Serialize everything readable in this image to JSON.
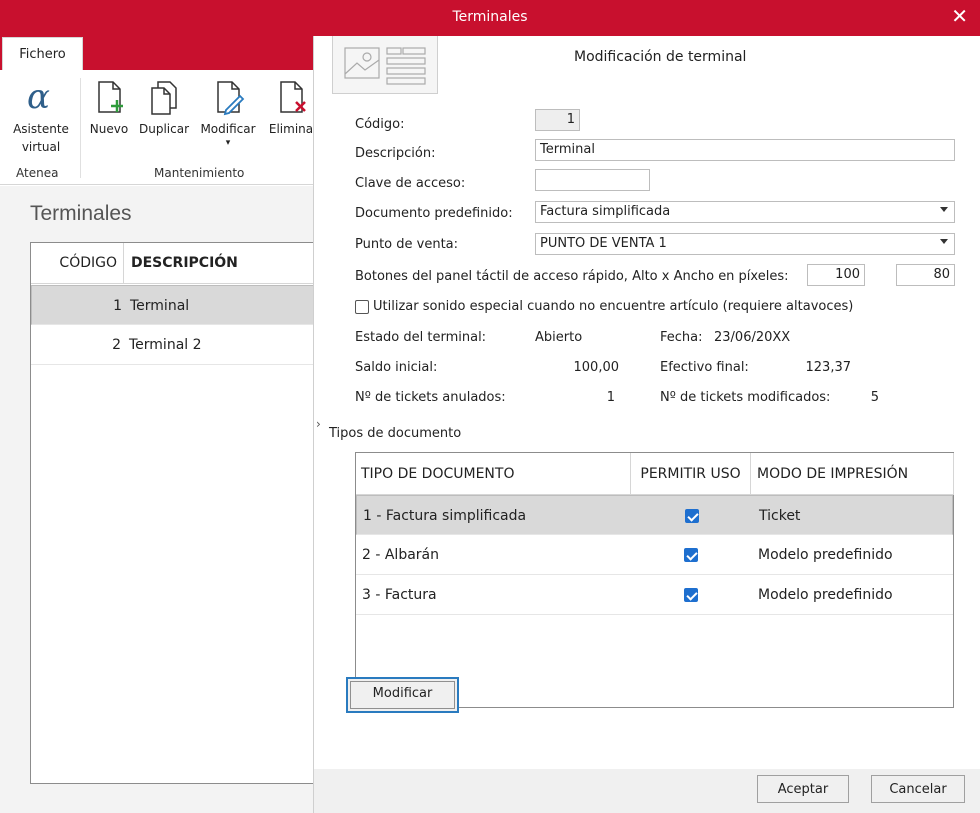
{
  "window": {
    "title": "Terminales"
  },
  "ribbon": {
    "tab": "Fichero",
    "buttons": {
      "asistente": "Asistente virtual",
      "nuevo": "Nuevo",
      "duplicar": "Duplicar",
      "modificar": "Modificar",
      "eliminar": "Elimina"
    },
    "groups": {
      "atenea": "Atenea",
      "mantenimiento": "Mantenimiento"
    }
  },
  "list": {
    "heading": "Terminales",
    "columns": {
      "codigo": "CÓDIGO",
      "descripcion": "DESCRIPCIÓN"
    },
    "rows": [
      {
        "codigo": "1",
        "descripcion": "Terminal"
      },
      {
        "codigo": "2",
        "descripcion": "Terminal 2"
      }
    ]
  },
  "dialog": {
    "title": "Modificación de terminal",
    "labels": {
      "codigo": "Código:",
      "descripcion": "Descripción:",
      "clave": "Clave de acceso:",
      "documento": "Documento predefinido:",
      "punto": "Punto de venta:",
      "botones": "Botones del panel táctil de acceso rápido, Alto x Ancho en píxeles:",
      "sonido": "Utilizar sonido especial cuando no encuentre artículo (requiere altavoces)",
      "estado": "Estado del terminal:",
      "fecha": "Fecha:",
      "saldo": "Saldo inicial:",
      "efectivo": "Efectivo final:",
      "anulados": "Nº de tickets anulados:",
      "modificados": "Nº de tickets modificados:"
    },
    "values": {
      "codigo": "1",
      "descripcion": "Terminal",
      "clave": "",
      "documento": "Factura simplificada",
      "punto": "PUNTO DE VENTA 1",
      "alto": "100",
      "ancho": "80",
      "estado": "Abierto",
      "fecha": "23/06/20XX",
      "saldo": "100,00",
      "efectivo": "123,37",
      "anulados": "1",
      "modificados": "5"
    },
    "section": "Tipos de documento",
    "docs_grid": {
      "columns": {
        "tipo": "TIPO DE DOCUMENTO",
        "permitir": "PERMITIR USO",
        "modo": "MODO DE IMPRESIÓN"
      },
      "rows": [
        {
          "tipo": "1 - Factura simplificada",
          "modo": "Ticket"
        },
        {
          "tipo": "2 - Albarán",
          "modo": "Modelo predefinido"
        },
        {
          "tipo": "3 - Factura",
          "modo": "Modelo predefinido"
        }
      ]
    },
    "buttons": {
      "modificar": "Modificar",
      "aceptar": "Aceptar",
      "cancelar": "Cancelar"
    }
  },
  "colors": {
    "brand": "#c8102e",
    "accent": "#1e6fcf",
    "selection": "#d9d9d9"
  },
  "icons": [
    "close-icon",
    "alpha-icon",
    "new-document-icon",
    "duplicate-icon",
    "edit-document-icon",
    "delete-document-icon",
    "dropdown-arrow-icon",
    "expand-caret-icon",
    "checkbox-icon",
    "terminal-card-icon"
  ]
}
